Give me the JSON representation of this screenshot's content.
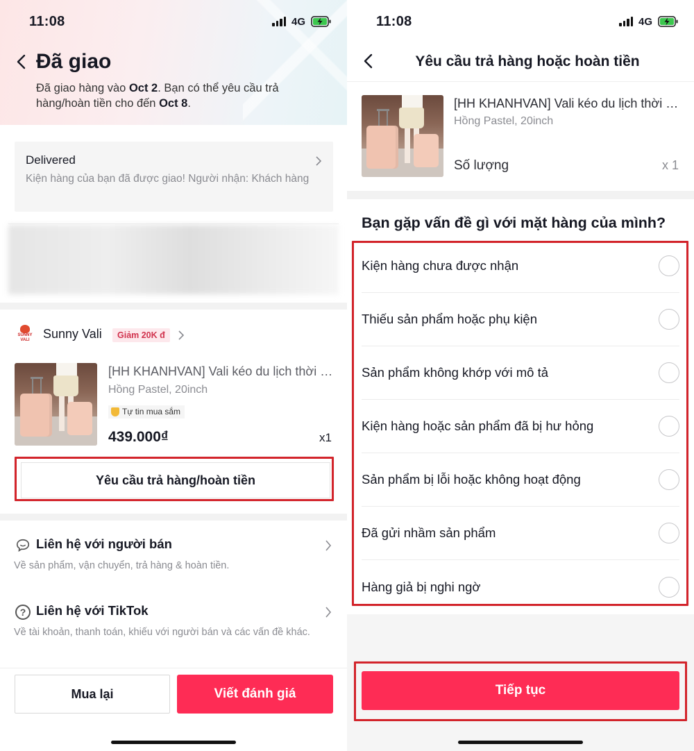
{
  "left": {
    "status": {
      "time": "11:08",
      "network": "4G"
    },
    "header": {
      "title": "Đã giao",
      "subtitle_parts": [
        "Đã giao hàng vào ",
        "Oct 2",
        ". Bạn có thể yêu cầu trả hàng/hoàn tiền cho đến ",
        "Oct 8",
        "."
      ]
    },
    "delivery": {
      "status": "Delivered",
      "message": "Kiện hàng của bạn đã được giao! Người nhận: Khách hàng"
    },
    "shop": {
      "logo_text": "SUNNY VALI",
      "name": "Sunny Vali",
      "badge": "Giảm 20K đ"
    },
    "product": {
      "title": "[HH KHANHVAN] Vali kéo du lịch thời trang",
      "variant": "Hồng Pastel, 20inch",
      "trust_badge": "Tự tin mua sắm",
      "price": "439.000₫",
      "quantity": "x1"
    },
    "request_button": "Yêu cầu trả hàng/hoàn tiền",
    "contacts": [
      {
        "icon": "chat-icon",
        "title": "Liên hệ với người bán",
        "desc": "Về sản phẩm, vận chuyển, trả hàng & hoàn tiền."
      },
      {
        "icon": "help-icon",
        "title": "Liên hệ với TikTok",
        "desc": "Về tài khoản, thanh toán, khiếu với người bán và các vấn đề khác."
      }
    ],
    "buttons": {
      "buy_again": "Mua lại",
      "review": "Viết đánh giá"
    }
  },
  "right": {
    "status": {
      "time": "11:08",
      "network": "4G"
    },
    "header": {
      "title": "Yêu cầu trả hàng hoặc hoàn tiền"
    },
    "product": {
      "title": "[HH KHANHVAN] Vali kéo du lịch thời trang",
      "variant": "Hồng Pastel, 20inch",
      "qty_label": "Số lượng",
      "quantity": "x 1"
    },
    "question": "Bạn gặp vấn đề gì với mặt hàng của mình?",
    "options": [
      "Kiện hàng chưa được nhận",
      "Thiếu sản phẩm hoặc phụ kiện",
      "Sản phẩm không khớp với mô tả",
      "Kiện hàng hoặc sản phẩm đã bị hư hỏng",
      "Sản phẩm bị lỗi hoặc không hoạt động",
      "Đã gửi nhầm sản phẩm",
      "Hàng giả bị nghi ngờ"
    ],
    "continue_button": "Tiếp tục"
  },
  "colors": {
    "accent": "#fe2c55",
    "highlight": "#d3242b",
    "text": "#161823",
    "muted": "#8a8b91"
  }
}
